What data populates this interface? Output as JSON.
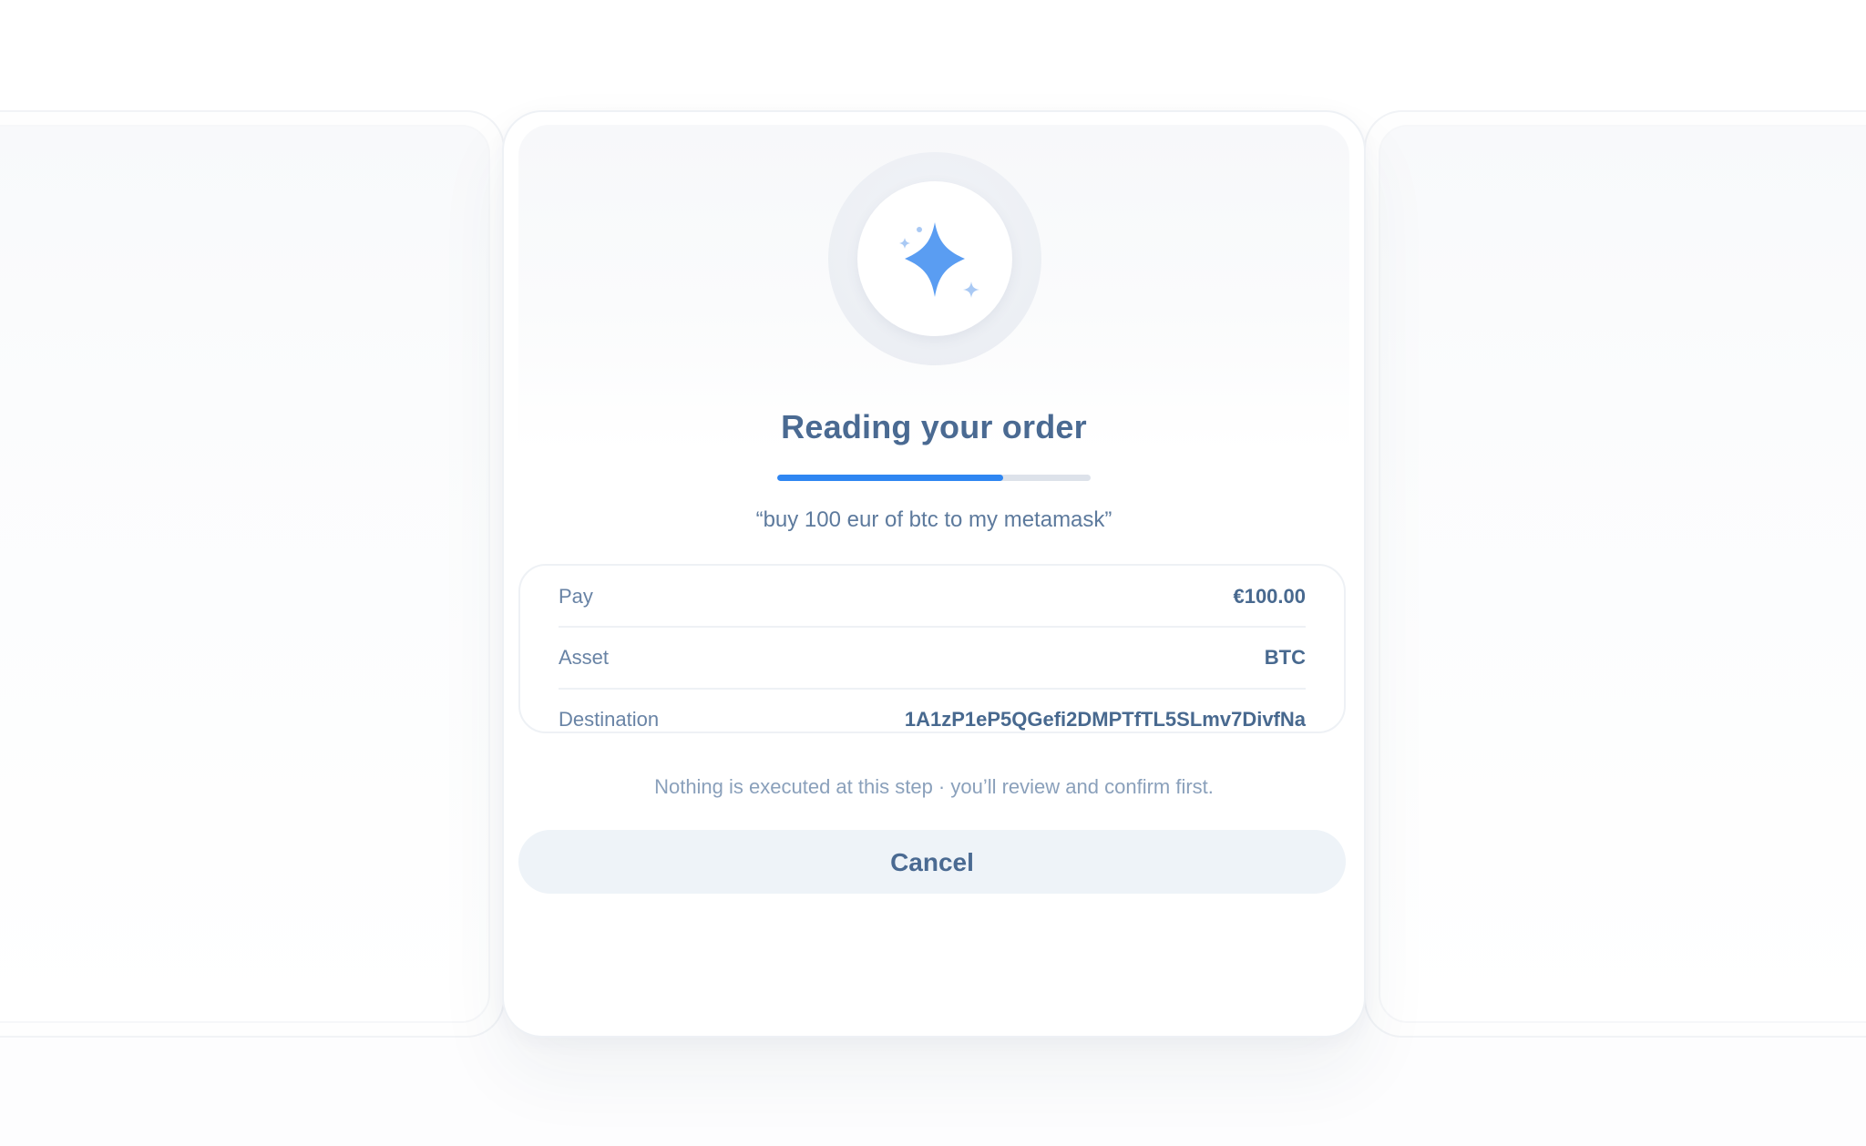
{
  "status": {
    "title": "Reading your order",
    "progress_percent": 72,
    "quote": "“buy 100 eur of btc to my metamask”"
  },
  "icon": {
    "name": "sparkle-icon",
    "primary_color": "#5a9df2",
    "secondary_color": "#a9c9f4"
  },
  "order": {
    "rows": [
      {
        "label": "Pay",
        "value": "€100.00"
      },
      {
        "label": "Asset",
        "value": "BTC"
      },
      {
        "label": "Destination",
        "value": "1A1zP1eP5QGefi2DMPTfTL5SLmv7DivfNa"
      }
    ]
  },
  "note": "Nothing is executed at this step · you’ll review and confirm first.",
  "actions": {
    "cancel_label": "Cancel"
  },
  "colors": {
    "accent": "#2f86f2",
    "text_primary": "#4a6a92"
  }
}
